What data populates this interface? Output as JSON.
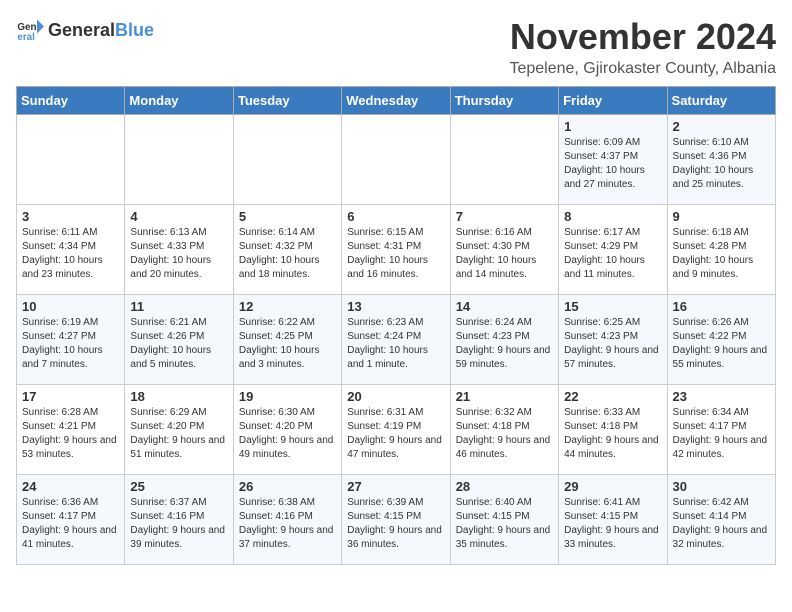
{
  "logo": {
    "text_general": "General",
    "text_blue": "Blue"
  },
  "title": "November 2024",
  "location": "Tepelene, Gjirokaster County, Albania",
  "weekdays": [
    "Sunday",
    "Monday",
    "Tuesday",
    "Wednesday",
    "Thursday",
    "Friday",
    "Saturday"
  ],
  "weeks": [
    [
      {
        "day": "",
        "info": ""
      },
      {
        "day": "",
        "info": ""
      },
      {
        "day": "",
        "info": ""
      },
      {
        "day": "",
        "info": ""
      },
      {
        "day": "",
        "info": ""
      },
      {
        "day": "1",
        "info": "Sunrise: 6:09 AM\nSunset: 4:37 PM\nDaylight: 10 hours and 27 minutes."
      },
      {
        "day": "2",
        "info": "Sunrise: 6:10 AM\nSunset: 4:36 PM\nDaylight: 10 hours and 25 minutes."
      }
    ],
    [
      {
        "day": "3",
        "info": "Sunrise: 6:11 AM\nSunset: 4:34 PM\nDaylight: 10 hours and 23 minutes."
      },
      {
        "day": "4",
        "info": "Sunrise: 6:13 AM\nSunset: 4:33 PM\nDaylight: 10 hours and 20 minutes."
      },
      {
        "day": "5",
        "info": "Sunrise: 6:14 AM\nSunset: 4:32 PM\nDaylight: 10 hours and 18 minutes."
      },
      {
        "day": "6",
        "info": "Sunrise: 6:15 AM\nSunset: 4:31 PM\nDaylight: 10 hours and 16 minutes."
      },
      {
        "day": "7",
        "info": "Sunrise: 6:16 AM\nSunset: 4:30 PM\nDaylight: 10 hours and 14 minutes."
      },
      {
        "day": "8",
        "info": "Sunrise: 6:17 AM\nSunset: 4:29 PM\nDaylight: 10 hours and 11 minutes."
      },
      {
        "day": "9",
        "info": "Sunrise: 6:18 AM\nSunset: 4:28 PM\nDaylight: 10 hours and 9 minutes."
      }
    ],
    [
      {
        "day": "10",
        "info": "Sunrise: 6:19 AM\nSunset: 4:27 PM\nDaylight: 10 hours and 7 minutes."
      },
      {
        "day": "11",
        "info": "Sunrise: 6:21 AM\nSunset: 4:26 PM\nDaylight: 10 hours and 5 minutes."
      },
      {
        "day": "12",
        "info": "Sunrise: 6:22 AM\nSunset: 4:25 PM\nDaylight: 10 hours and 3 minutes."
      },
      {
        "day": "13",
        "info": "Sunrise: 6:23 AM\nSunset: 4:24 PM\nDaylight: 10 hours and 1 minute."
      },
      {
        "day": "14",
        "info": "Sunrise: 6:24 AM\nSunset: 4:23 PM\nDaylight: 9 hours and 59 minutes."
      },
      {
        "day": "15",
        "info": "Sunrise: 6:25 AM\nSunset: 4:23 PM\nDaylight: 9 hours and 57 minutes."
      },
      {
        "day": "16",
        "info": "Sunrise: 6:26 AM\nSunset: 4:22 PM\nDaylight: 9 hours and 55 minutes."
      }
    ],
    [
      {
        "day": "17",
        "info": "Sunrise: 6:28 AM\nSunset: 4:21 PM\nDaylight: 9 hours and 53 minutes."
      },
      {
        "day": "18",
        "info": "Sunrise: 6:29 AM\nSunset: 4:20 PM\nDaylight: 9 hours and 51 minutes."
      },
      {
        "day": "19",
        "info": "Sunrise: 6:30 AM\nSunset: 4:20 PM\nDaylight: 9 hours and 49 minutes."
      },
      {
        "day": "20",
        "info": "Sunrise: 6:31 AM\nSunset: 4:19 PM\nDaylight: 9 hours and 47 minutes."
      },
      {
        "day": "21",
        "info": "Sunrise: 6:32 AM\nSunset: 4:18 PM\nDaylight: 9 hours and 46 minutes."
      },
      {
        "day": "22",
        "info": "Sunrise: 6:33 AM\nSunset: 4:18 PM\nDaylight: 9 hours and 44 minutes."
      },
      {
        "day": "23",
        "info": "Sunrise: 6:34 AM\nSunset: 4:17 PM\nDaylight: 9 hours and 42 minutes."
      }
    ],
    [
      {
        "day": "24",
        "info": "Sunrise: 6:36 AM\nSunset: 4:17 PM\nDaylight: 9 hours and 41 minutes."
      },
      {
        "day": "25",
        "info": "Sunrise: 6:37 AM\nSunset: 4:16 PM\nDaylight: 9 hours and 39 minutes."
      },
      {
        "day": "26",
        "info": "Sunrise: 6:38 AM\nSunset: 4:16 PM\nDaylight: 9 hours and 37 minutes."
      },
      {
        "day": "27",
        "info": "Sunrise: 6:39 AM\nSunset: 4:15 PM\nDaylight: 9 hours and 36 minutes."
      },
      {
        "day": "28",
        "info": "Sunrise: 6:40 AM\nSunset: 4:15 PM\nDaylight: 9 hours and 35 minutes."
      },
      {
        "day": "29",
        "info": "Sunrise: 6:41 AM\nSunset: 4:15 PM\nDaylight: 9 hours and 33 minutes."
      },
      {
        "day": "30",
        "info": "Sunrise: 6:42 AM\nSunset: 4:14 PM\nDaylight: 9 hours and 32 minutes."
      }
    ]
  ]
}
